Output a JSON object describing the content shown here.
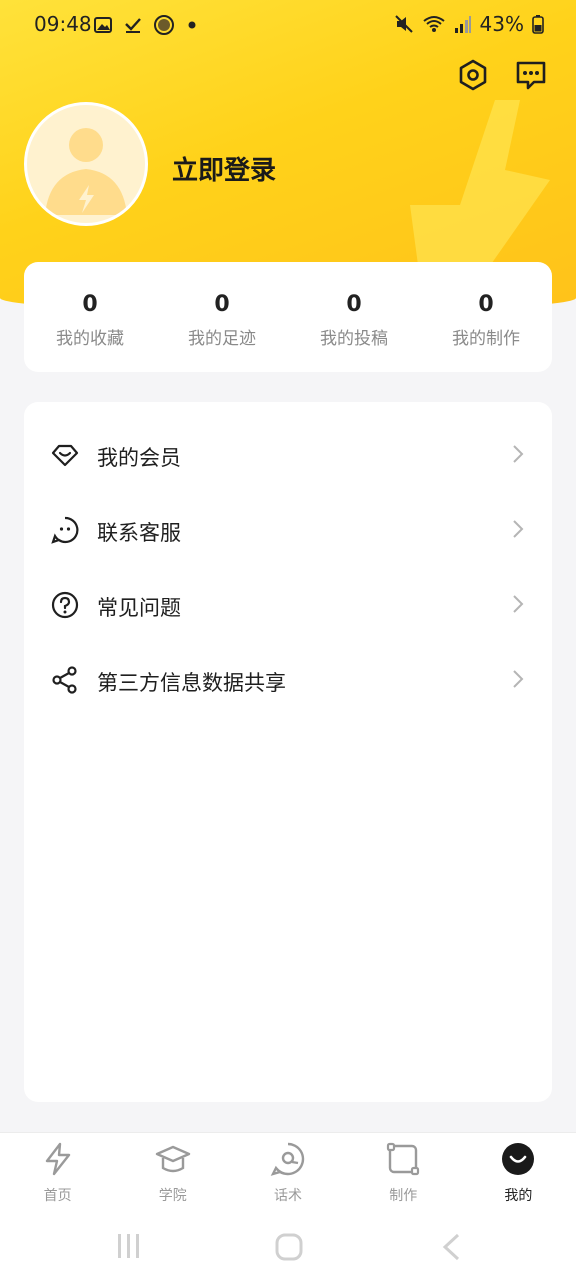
{
  "status_bar": {
    "time": "09:48",
    "battery": "43%",
    "left_icons": [
      "image-icon",
      "check-icon",
      "circle-app-icon",
      "dot-icon"
    ],
    "right_icons": [
      "mute-icon",
      "wifi-icon",
      "signal-icon",
      "battery-icon"
    ]
  },
  "header": {
    "settings_icon": "settings-hex-icon",
    "message_icon": "message-icon",
    "login_label": "立即登录"
  },
  "stats": [
    {
      "value": "0",
      "label": "我的收藏"
    },
    {
      "value": "0",
      "label": "我的足迹"
    },
    {
      "value": "0",
      "label": "我的投稿"
    },
    {
      "value": "0",
      "label": "我的制作"
    }
  ],
  "menu": [
    {
      "label": "我的会员",
      "icon": "membership-diamond-icon"
    },
    {
      "label": "联系客服",
      "icon": "customer-service-icon"
    },
    {
      "label": "常见问题",
      "icon": "question-icon"
    },
    {
      "label": "第三方信息数据共享",
      "icon": "share-icon"
    }
  ],
  "tabs": [
    {
      "label": "首页",
      "icon": "home-bolt-icon",
      "active": false
    },
    {
      "label": "学院",
      "icon": "graduation-cap-icon",
      "active": false
    },
    {
      "label": "话术",
      "icon": "chat-bubble-icon",
      "active": false
    },
    {
      "label": "制作",
      "icon": "create-frame-icon",
      "active": false
    },
    {
      "label": "我的",
      "icon": "profile-smile-icon",
      "active": true
    }
  ],
  "colors": {
    "accent": "#ffd21a",
    "background": "#f5f5f7"
  }
}
